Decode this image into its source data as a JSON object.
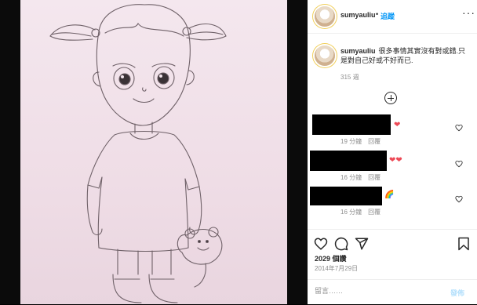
{
  "post": {
    "username": "sumyauliu",
    "dot": "•",
    "follow_label": "追蹤",
    "more_icon": "more-horizontal-icon",
    "caption_username": "sumyauliu",
    "caption_text": "很多事情其實沒有對或錯.只是對自己好或不好而已.",
    "caption_time": "315 週",
    "likes": "2029 個讚",
    "date": "2014年7月29日"
  },
  "comments": [
    {
      "emoji": "❤",
      "time": "19 分鐘",
      "reply": "回覆"
    },
    {
      "emoji": "❤❤",
      "time": "16 分鐘",
      "reply": "回覆"
    },
    {
      "emoji": "🌈",
      "time": "16 分鐘",
      "reply": "回覆"
    }
  ],
  "comment_box": {
    "placeholder": "留言……",
    "post_label": "發佈"
  },
  "icons": [
    "heart-icon",
    "comment-icon",
    "share-icon",
    "bookmark-icon",
    "add-comments-icon"
  ],
  "colors": {
    "accent": "#0095f6",
    "post_disabled": "#b2dffc",
    "heart": "#ed4956"
  }
}
